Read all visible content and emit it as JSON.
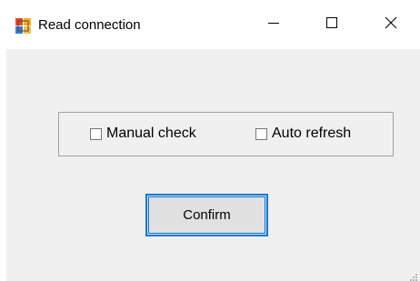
{
  "window": {
    "title": "Read connection",
    "icons": {
      "app": "app-icon",
      "minimize": "minimize-icon",
      "maximize": "maximize-icon",
      "close": "close-icon",
      "grip": "resize-grip-icon"
    }
  },
  "options": {
    "manual_check": {
      "label": "Manual check",
      "checked": false
    },
    "auto_refresh": {
      "label": "Auto refresh",
      "checked": false
    }
  },
  "actions": {
    "confirm_label": "Confirm"
  },
  "colors": {
    "client_bg": "#f0f0f0",
    "focus_border": "#0078d7",
    "button_bg": "#e1e1e1",
    "group_border": "#a0a0a0"
  }
}
